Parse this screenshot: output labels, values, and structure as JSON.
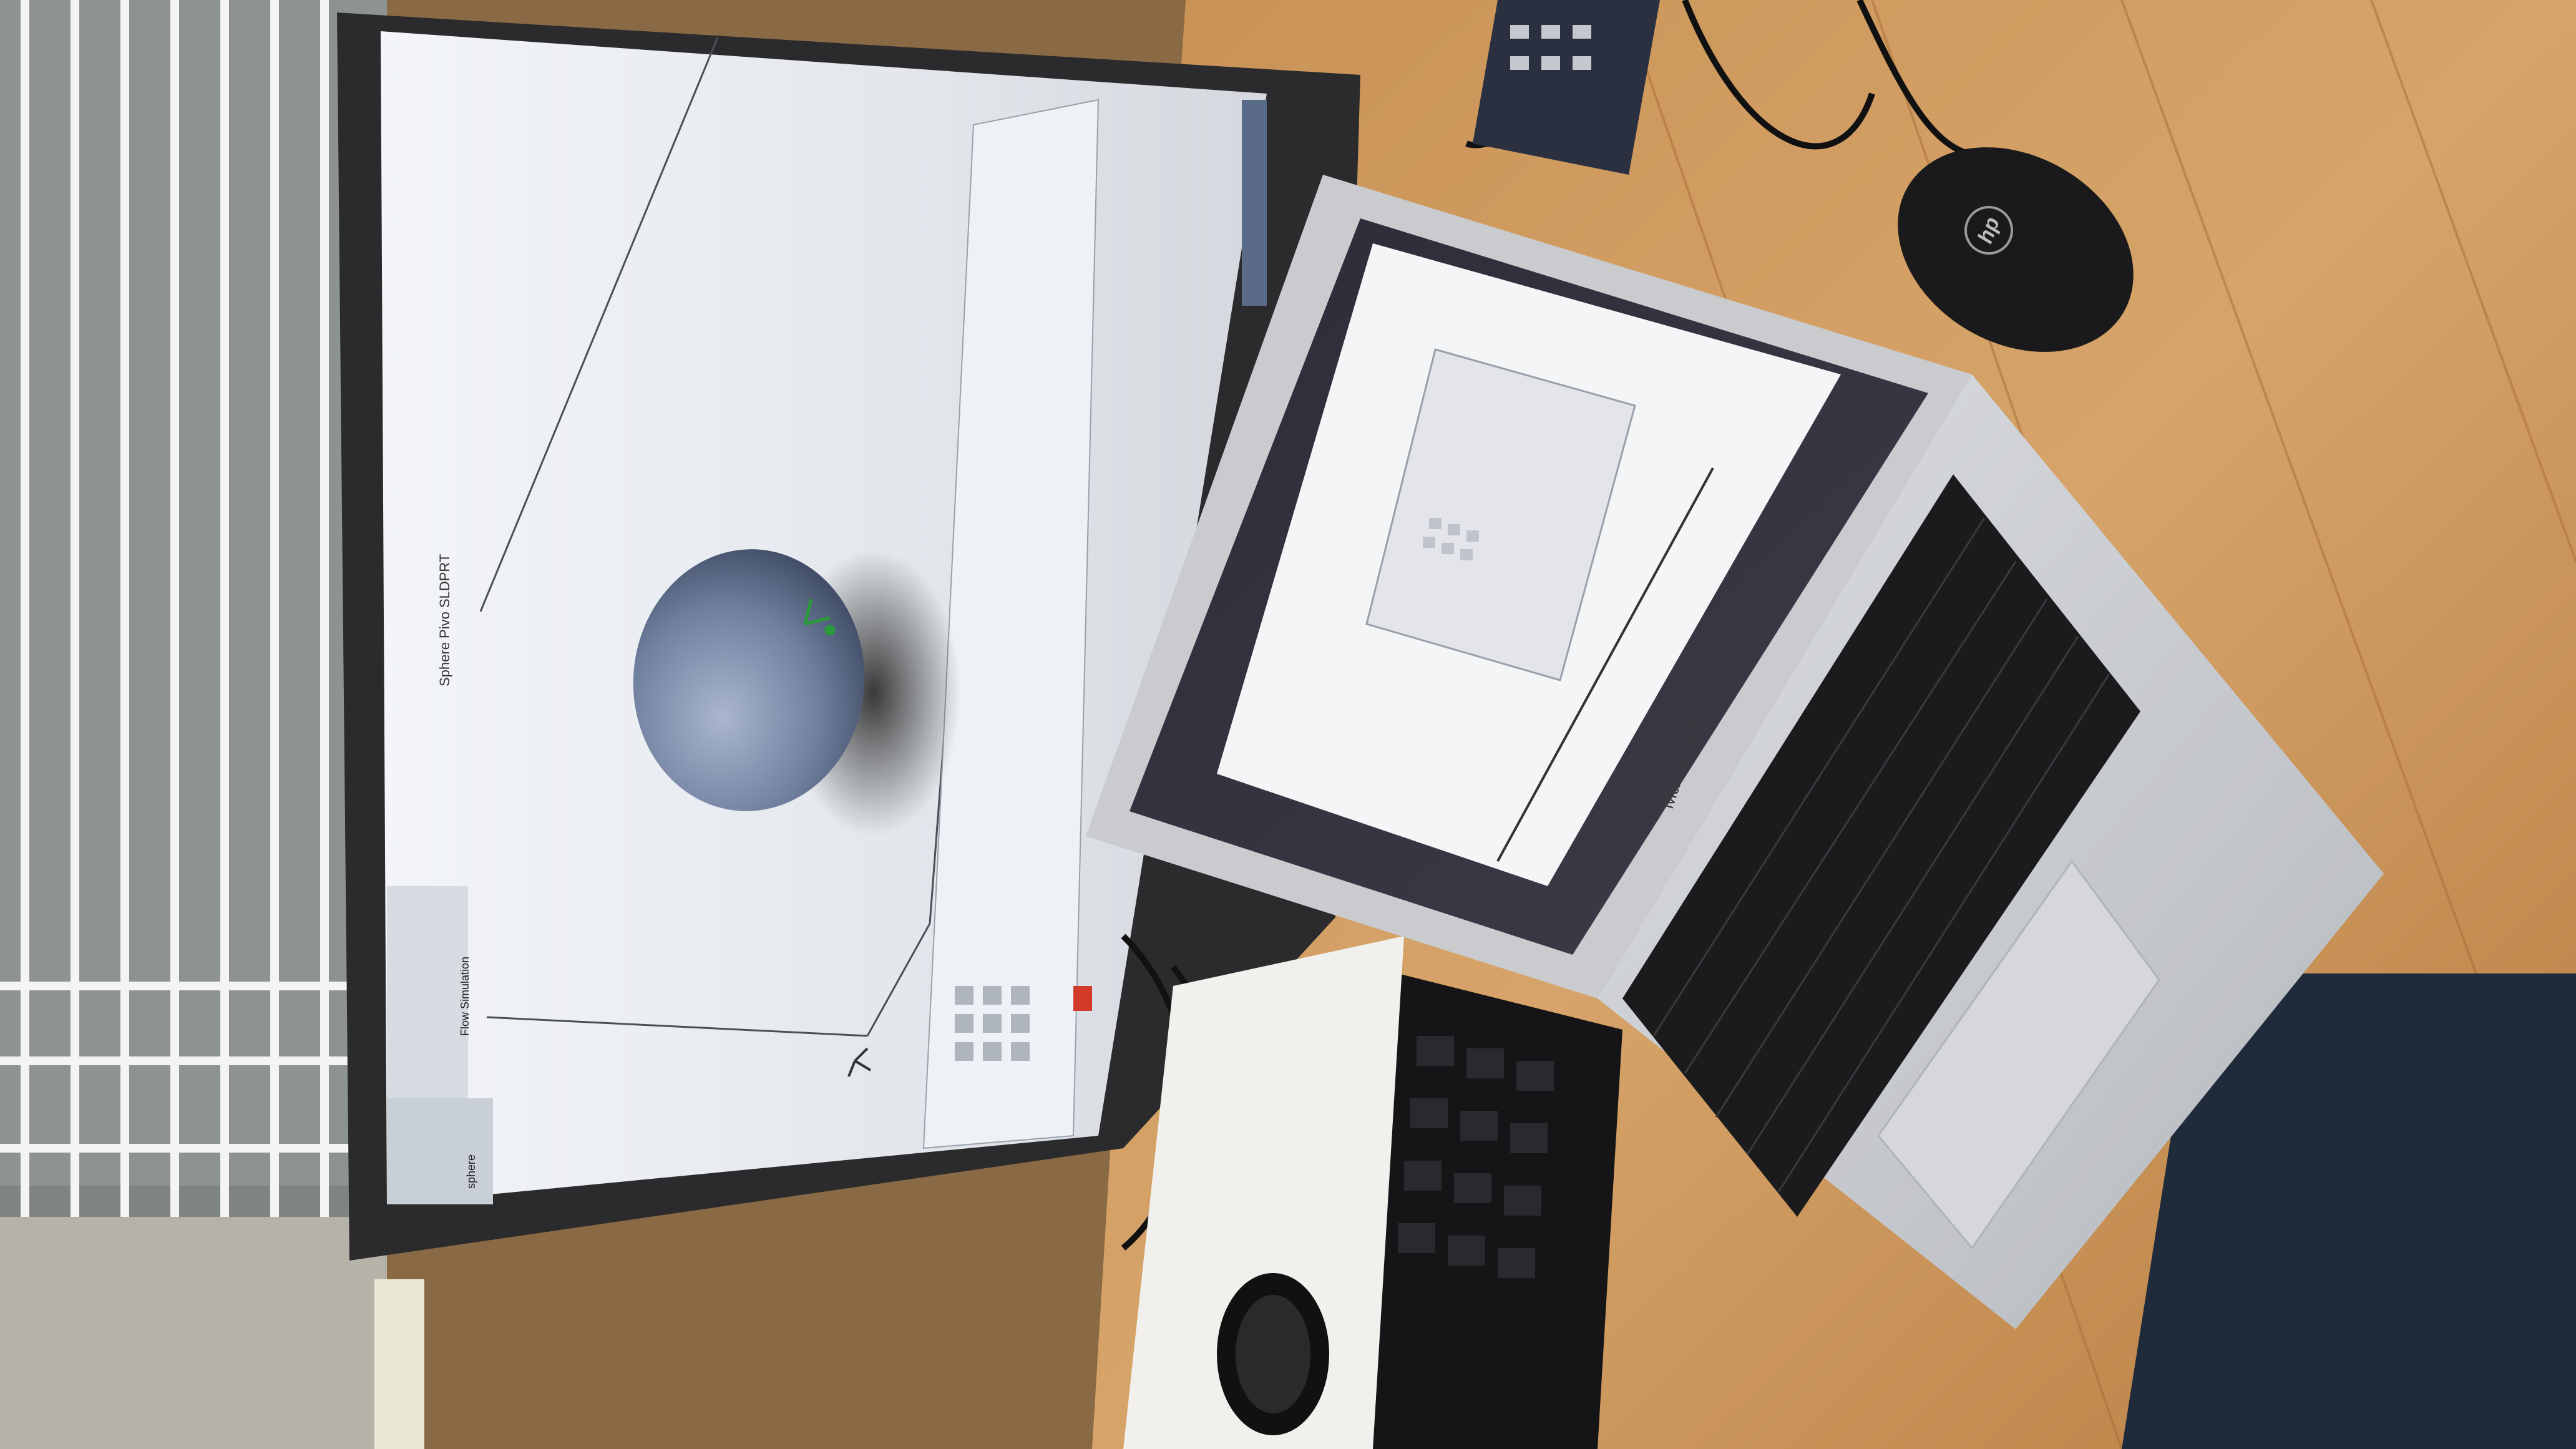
{
  "scene": {
    "description_free": true,
    "colors": {
      "desk": "#c38a4c",
      "desk_light": "#d9a66a",
      "monitor_bezel": "#2b2b2d",
      "monitor_screen": "#e4e8ee",
      "sphere": "#7a8aa8",
      "laptop_body": "#c9cbcf",
      "laptop_keys": "#1b1b1d",
      "mouse": "#1a1a1c",
      "keyboard": "#151517",
      "shelf": "#f2f2f2"
    }
  },
  "monitor": {
    "app_window_tab": "Sphere Pivo SLDPRT",
    "feature_tree_item": "sphere",
    "command_tab": "Flow Simulation"
  },
  "laptop": {
    "brand_label": "MacBook Air"
  },
  "mouse": {
    "brand_label": "hp"
  }
}
